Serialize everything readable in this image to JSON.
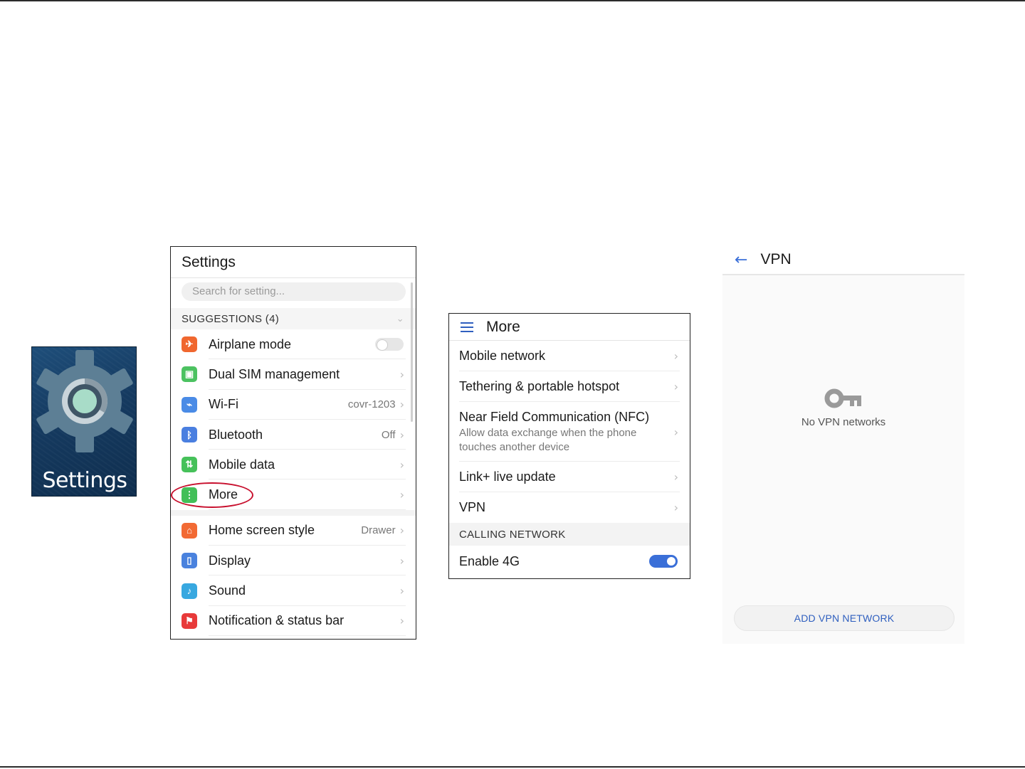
{
  "app_tile": {
    "label": "Settings"
  },
  "settings_screen": {
    "title": "Settings",
    "search_placeholder": "Search for setting...",
    "suggestions_header": "SUGGESTIONS (4)",
    "group1": [
      {
        "label": "Airplane mode",
        "value": "",
        "icon": "airplane-icon",
        "color": "#f0672f",
        "control": "toggle-off"
      },
      {
        "label": "Dual SIM management",
        "value": "",
        "icon": "sim-icon",
        "color": "#4cc261",
        "control": "chevron"
      },
      {
        "label": "Wi-Fi",
        "value": "covr-1203",
        "icon": "wifi-icon",
        "color": "#4a8be6",
        "control": "chevron"
      },
      {
        "label": "Bluetooth",
        "value": "Off",
        "icon": "bluetooth-icon",
        "color": "#4a7fe0",
        "control": "chevron"
      },
      {
        "label": "Mobile data",
        "value": "",
        "icon": "mobile-data-icon",
        "color": "#46c15a",
        "control": "chevron"
      },
      {
        "label": "More",
        "value": "",
        "icon": "more-icon",
        "color": "#42bf58",
        "control": "chevron"
      }
    ],
    "group2": [
      {
        "label": "Home screen style",
        "value": "Drawer",
        "icon": "home-icon",
        "color": "#f26a34"
      },
      {
        "label": "Display",
        "value": "",
        "icon": "display-icon",
        "color": "#4a82de"
      },
      {
        "label": "Sound",
        "value": "",
        "icon": "sound-icon",
        "color": "#38a8e0"
      },
      {
        "label": "Notification & status bar",
        "value": "",
        "icon": "notification-icon",
        "color": "#e83a3a"
      }
    ]
  },
  "more_screen": {
    "title": "More",
    "items": [
      {
        "label": "Mobile network",
        "sub": ""
      },
      {
        "label": "Tethering & portable hotspot",
        "sub": ""
      },
      {
        "label": "Near Field Communication (NFC)",
        "sub": "Allow data exchange when the phone touches another device"
      },
      {
        "label": "Link+ live update",
        "sub": ""
      },
      {
        "label": "VPN",
        "sub": ""
      }
    ],
    "calling_header": "CALLING NETWORK",
    "enable_4g": "Enable 4G",
    "enable_4g_on": true
  },
  "vpn_screen": {
    "title": "VPN",
    "empty_message": "No VPN networks",
    "add_button": "ADD VPN NETWORK"
  },
  "colors": {
    "accent": "#3a6fd8",
    "highlight_circle": "#c8102e"
  }
}
